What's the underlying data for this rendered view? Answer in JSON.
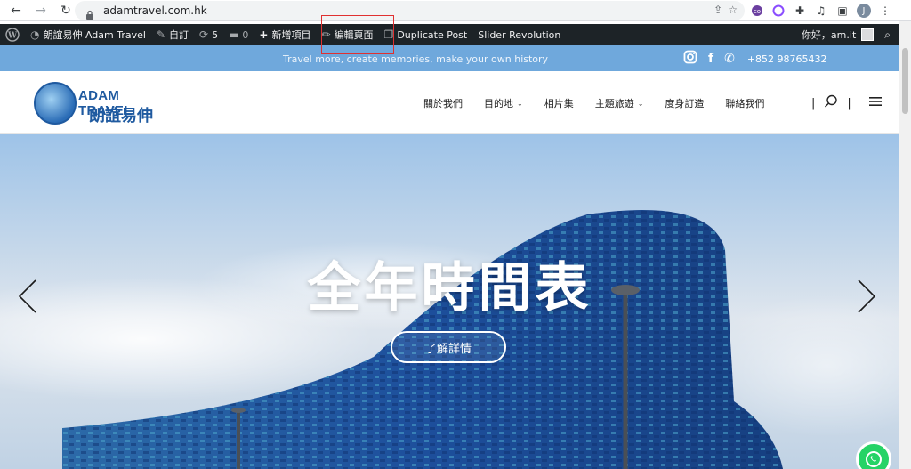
{
  "browser": {
    "url": "adamtravel.com.hk",
    "avatar_letter": "J"
  },
  "admin_bar": {
    "site_name": "朗誼易伸 Adam Travel",
    "customize": "自訂",
    "updates_count": "5",
    "comments_count": "0",
    "new": "新增項目",
    "edit_page": "編輯頁面",
    "duplicate_post": "Duplicate Post",
    "slider_revolution": "Slider Revolution",
    "greeting": "你好，am.it"
  },
  "top_bar": {
    "tagline": "Travel more, create memories, make your own history",
    "phone": "+852 98765432"
  },
  "logo": {
    "title": "ADAM TRAVEL",
    "subtitle": "朗誼易伸"
  },
  "nav": {
    "items": [
      {
        "label": "關於我們",
        "has_dropdown": false
      },
      {
        "label": "目的地",
        "has_dropdown": true
      },
      {
        "label": "相片集",
        "has_dropdown": false
      },
      {
        "label": "主題旅遊",
        "has_dropdown": true
      },
      {
        "label": "度身訂造",
        "has_dropdown": false
      },
      {
        "label": "聯絡我們",
        "has_dropdown": false
      }
    ]
  },
  "hero": {
    "title": "全年時間表",
    "button": "了解詳情"
  },
  "colors": {
    "admin_bar_bg": "#1d2327",
    "top_bar_bg": "#6fa8dc",
    "brand_blue": "#1f5aa0",
    "highlight": "#e03030",
    "whatsapp": "#25d366"
  },
  "icons": [
    "back-arrow-icon",
    "forward-arrow-icon",
    "reload-icon",
    "lock-icon",
    "share-icon",
    "star-icon",
    "wordpress-icon",
    "dashboard-icon",
    "brush-icon",
    "refresh-icon",
    "comment-icon",
    "plus-icon",
    "pencil-icon",
    "duplicate-icon",
    "search-icon",
    "instagram-icon",
    "facebook-icon",
    "phone-icon",
    "menu-icon",
    "whatsapp-icon"
  ]
}
